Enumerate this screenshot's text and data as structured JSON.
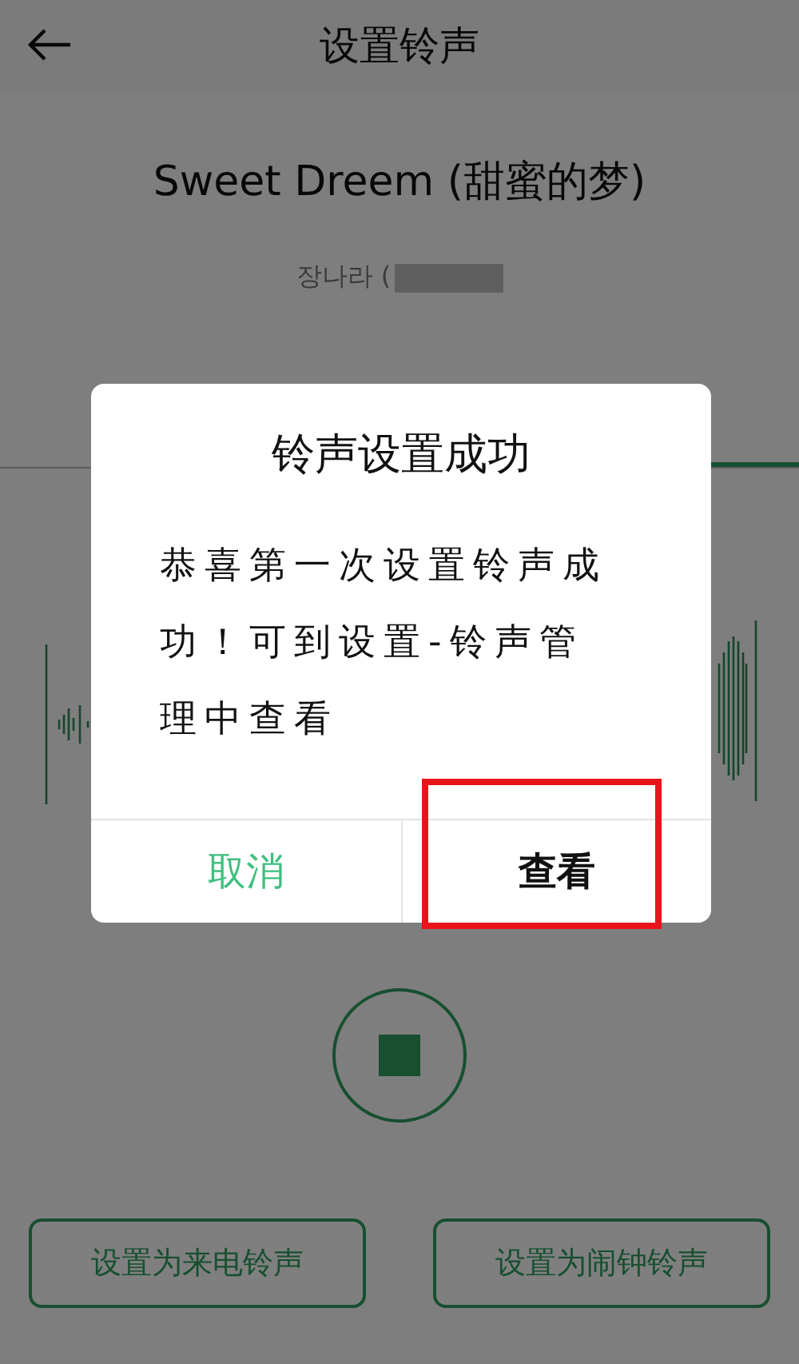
{
  "header": {
    "title": "设置铃声"
  },
  "song": {
    "title": "Sweet Dreem (甜蜜的梦)",
    "artist": "장나라 (",
    "artist_blurred": true
  },
  "tabs": [
    {
      "selected": false
    },
    {
      "selected": true
    }
  ],
  "player": {
    "playing": true
  },
  "actions": [
    "设置为来电铃声",
    "设置为闹钟铃声"
  ],
  "dialog": {
    "title": "铃声设置成功",
    "message": "恭喜第一次设置铃声成功！可到设置-铃声管理中查看",
    "buttons": [
      {
        "label": "取消",
        "kind": "cancel",
        "highlighted": false
      },
      {
        "label": "查看",
        "kind": "confirm",
        "highlighted": true
      }
    ]
  }
}
